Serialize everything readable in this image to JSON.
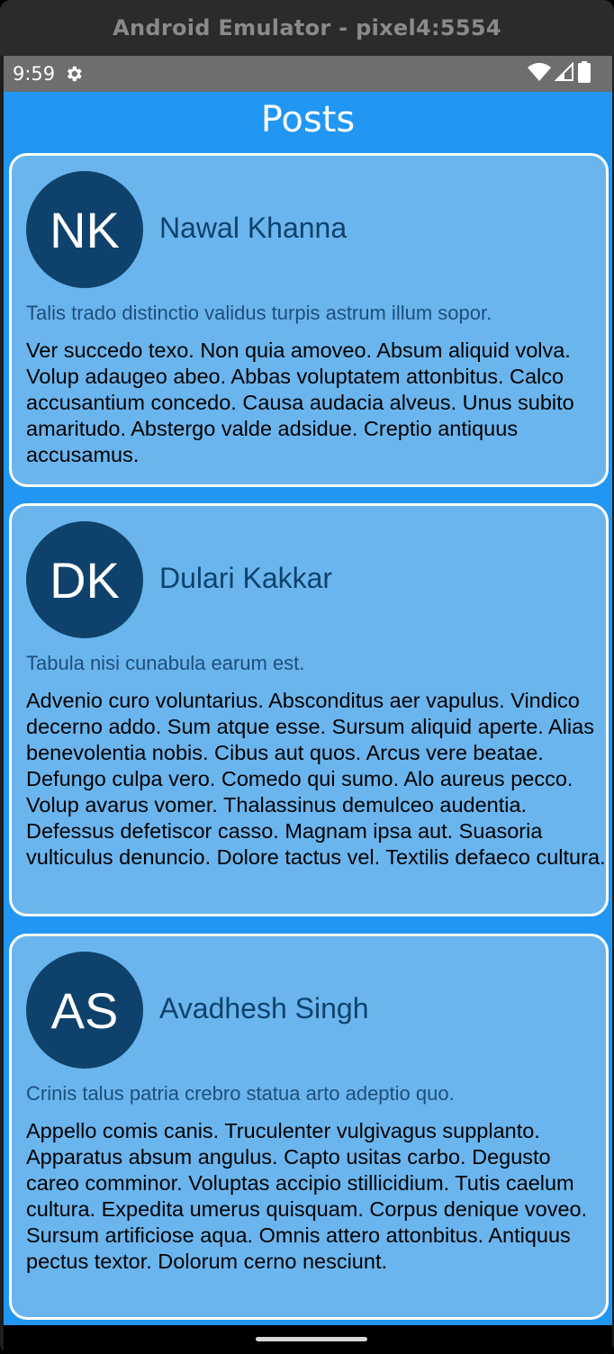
{
  "window": {
    "title": "Android Emulator - pixel4:5554"
  },
  "status_bar": {
    "time": "9:59",
    "icons": [
      "gear-icon",
      "wifi-icon",
      "signal-icon",
      "battery-icon"
    ]
  },
  "app_bar": {
    "title": "Posts"
  },
  "colors": {
    "background": "#2196f3",
    "card": "#6bb5ee",
    "avatar": "#0e426c",
    "author_text": "#0e426c",
    "title_text": "#1d4f7c"
  },
  "posts": [
    {
      "initials": "NK",
      "author": "Nawal Khanna",
      "title": "Talis trado distinctio validus turpis astrum illum sopor.",
      "body": "Ver succedo texo. Non quia amoveo. Absum aliquid volva. Volup adaugeo abeo. Abbas voluptatem attonbitus. Calco accusantium concedo. Causa audacia alveus. Unus subito amaritudo. Abstergo valde adsidue. Creptio antiquus accusamus."
    },
    {
      "initials": "DK",
      "author": "Dulari Kakkar",
      "title": "Tabula nisi cunabula earum est.",
      "body": "Advenio curo voluntarius. Absconditus aer vapulus. Vindico decerno addo. Sum atque esse. Sursum aliquid aperte. Alias benevolentia nobis. Cibus aut quos. Arcus vere beatae. Defungo culpa vero. Comedo qui sumo. Alo aureus pecco. Volup avarus vomer. Thalassinus demulceo audentia. Defessus defetiscor casso. Magnam ipsa aut. Suasoria vulticulus denuncio. Dolore tactus vel. Textilis defaeco cultura."
    },
    {
      "initials": "AS",
      "author": "Avadhesh Singh",
      "title": "Crinis talus patria crebro statua arto adeptio quo.",
      "body": "Appello comis canis. Truculenter vulgivagus supplanto. Apparatus absum angulus. Capto usitas carbo. Degusto careo comminor. Voluptas accipio stillicidium. Tutis caelum cultura. Expedita umerus quisquam. Corpus denique voveo. Sursum artificiose aqua. Omnis attero attonbitus. Antiquus pectus textor. Dolorum cerno nesciunt."
    }
  ]
}
